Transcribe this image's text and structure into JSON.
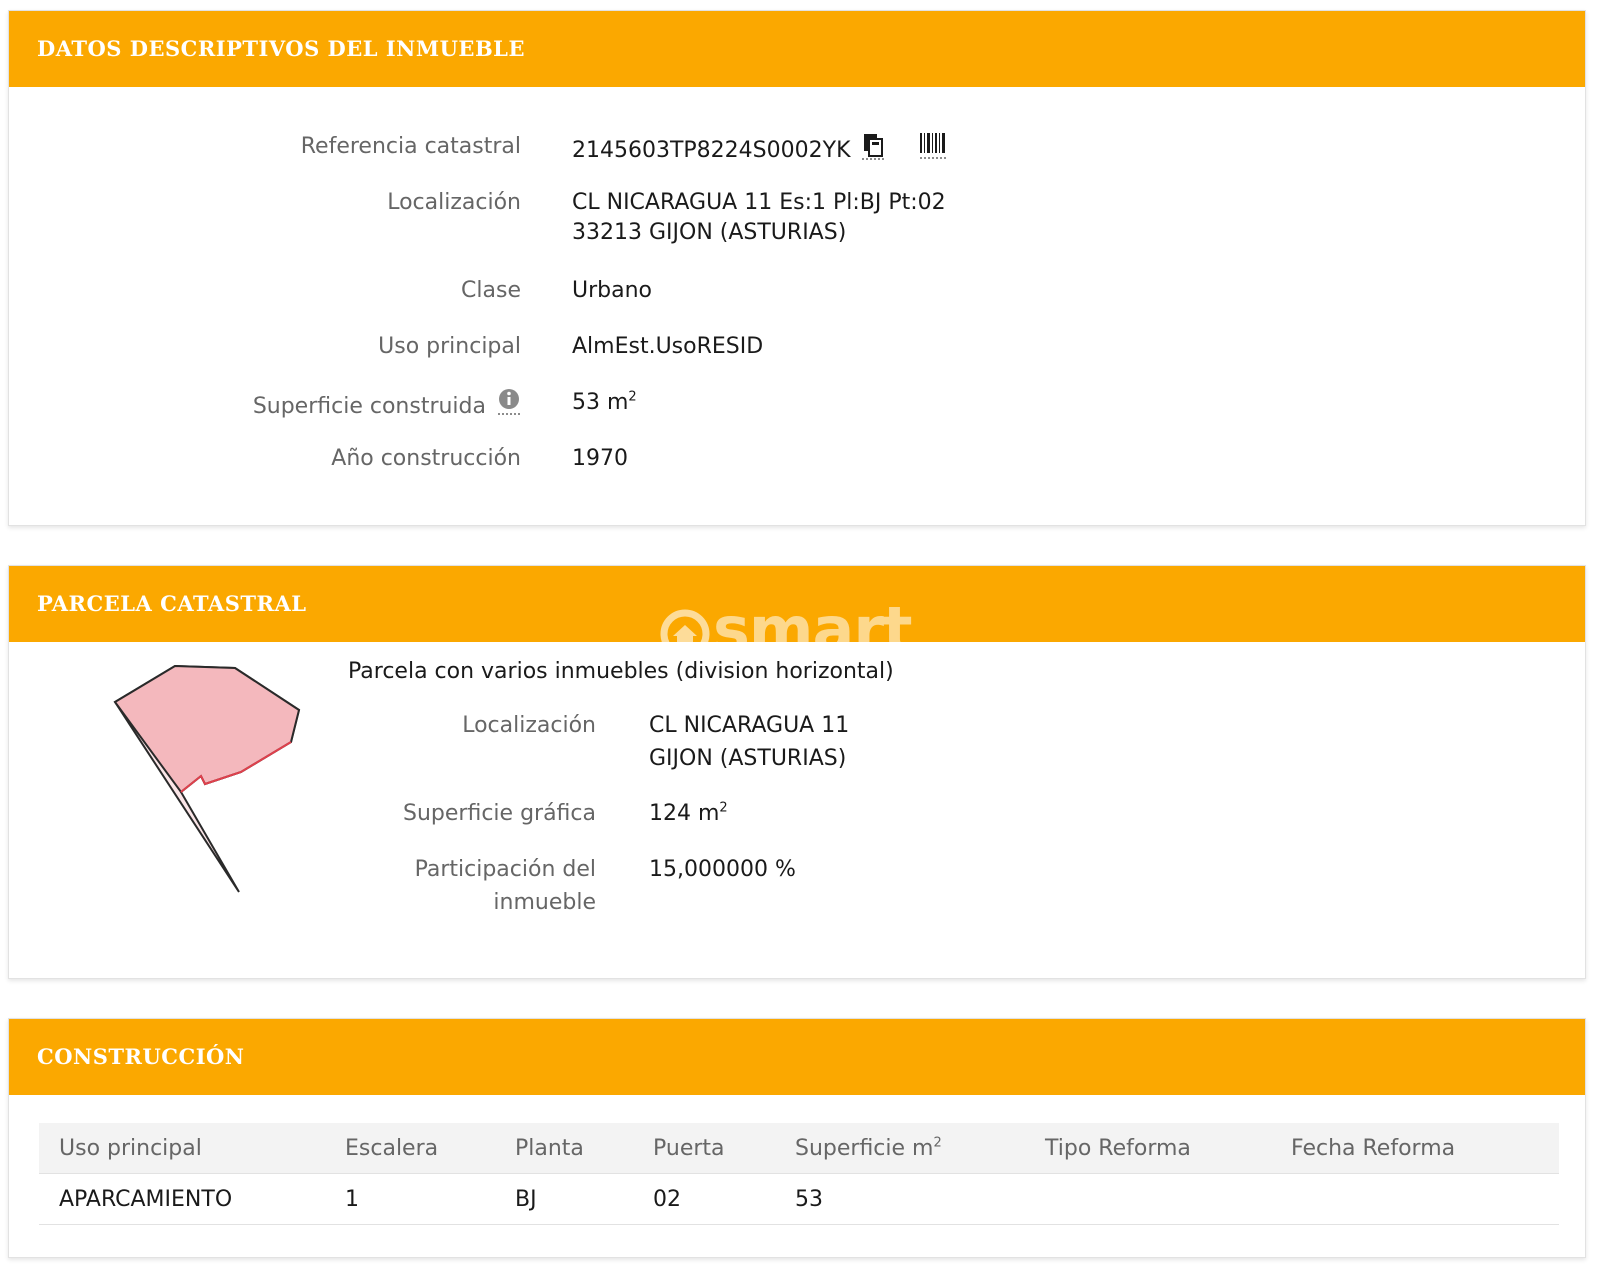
{
  "datos": {
    "title": "DATOS DESCRIPTIVOS DEL INMUEBLE",
    "referencia_label": "Referencia catastral",
    "referencia_value": "2145603TP8224S0002YK",
    "localizacion_label": "Localización",
    "localizacion_line1": "CL NICARAGUA 11 Es:1 Pl:BJ Pt:02",
    "localizacion_line2": "33213 GIJON (ASTURIAS)",
    "clase_label": "Clase",
    "clase_value": "Urbano",
    "uso_label": "Uso principal",
    "uso_value": "AlmEst.UsoRESID",
    "superficie_label": "Superficie construida",
    "superficie_value": "53 m",
    "superficie_sup": "2",
    "anio_label": "Año construcción",
    "anio_value": "1970"
  },
  "parcela": {
    "title": "PARCELA CATASTRAL",
    "watermark": "smart",
    "subtitle": "Parcela con varios inmuebles (division horizontal)",
    "localizacion_label": "Localización",
    "localizacion_line1": "CL NICARAGUA 11",
    "localizacion_line2": "GIJON (ASTURIAS)",
    "superficie_label": "Superficie gráfica",
    "superficie_value": "124 m",
    "superficie_sup": "2",
    "participacion_label_line1": "Participación del",
    "participacion_label_line2": "inmueble",
    "participacion_value": "15,000000 %"
  },
  "construccion": {
    "title": "CONSTRUCCIÓN",
    "columns": [
      "Uso principal",
      "Escalera",
      "Planta",
      "Puerta",
      "Superficie m",
      "Tipo Reforma",
      "Fecha Reforma"
    ],
    "superficie_col_sup": "2",
    "rows": [
      [
        "APARCAMIENTO",
        "1",
        "BJ",
        "02",
        "53",
        "",
        ""
      ]
    ]
  },
  "colors": {
    "header_bg": "#fba800",
    "label": "#666666",
    "parcel_fill": "#f4b8bd",
    "parcel_stroke": "#e0404c"
  },
  "icons": [
    "copy-icon",
    "barcode-icon",
    "info-icon"
  ]
}
